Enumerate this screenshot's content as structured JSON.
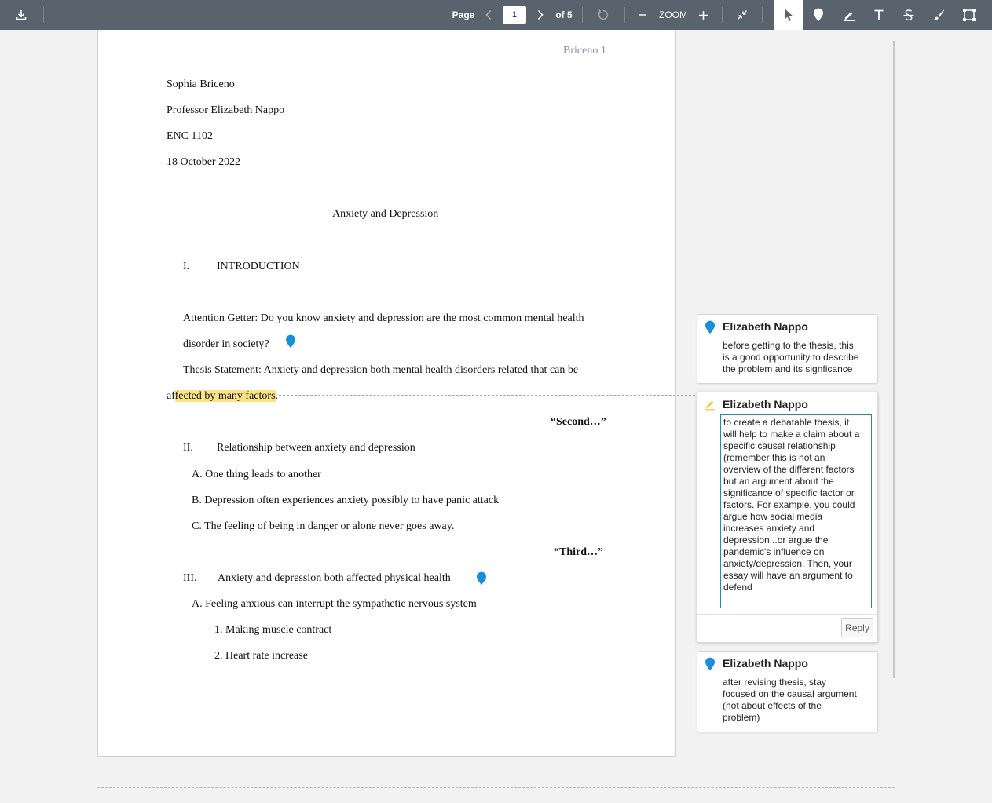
{
  "toolbar": {
    "page_label": "Page",
    "page_value": "1",
    "page_total": "of 5",
    "zoom_label": "ZOOM",
    "icons": [
      "download-icon",
      "chevron-left-icon",
      "chevron-right-icon",
      "rotate-icon",
      "minus-icon",
      "plus-icon",
      "collapse-icon",
      "pointer-icon",
      "pin-icon",
      "highlighter-icon",
      "text-icon",
      "strikethrough-icon",
      "brush-icon",
      "area-select-icon"
    ]
  },
  "document": {
    "header": "Briceno 1",
    "name": "Sophia Briceno",
    "professor": "Professor Elizabeth Nappo",
    "course": "ENC 1102",
    "date": "18 October 2022",
    "title": "Anxiety and Depression",
    "s1_num": "I.",
    "s1_title": "INTRODUCTION",
    "attention_1": "Attention Getter:  Do you know anxiety and depression are the most common mental health",
    "attention_2": "disorder in society?",
    "thesis_1": "Thesis Statement:  Anxiety and depression both mental health disorders related that can be",
    "thesis_2a": "af",
    "thesis_2b": "fected by many factors",
    "thesis_2c": ".",
    "second": "“Second…”",
    "s2_num": "II.",
    "s2_title": "Relationship between anxiety and depression",
    "s2_a": "A.  One thing leads to another",
    "s2_b": "B.  Depression often experiences anxiety possibly to have panic attack",
    "s2_c": "C.  The feeling of being in danger or alone never goes away.",
    "third": "“Third…”",
    "s3_num": "III.",
    "s3_title": "Anxiety and depression both affected physical health",
    "s3_a": "A.  Feeling anxious can interrupt the sympathetic nervous system",
    "s3_a1": "1.   Making muscle contract",
    "s3_a2": "2.   Heart rate increase"
  },
  "comments": [
    {
      "author": "Elizabeth Nappo",
      "icon": "pin-icon",
      "lines": [
        "before getting to the thesis, this",
        "is a good opportunity to describe",
        "the problem and its signficance"
      ]
    },
    {
      "author": "Elizabeth Nappo",
      "icon": "highlighter-icon",
      "lines": [
        "to create a debatable thesis, it",
        "will help to make a claim about a",
        "specific causal relationship",
        "(remember this is not an",
        "overview of the different factors",
        "but an argument about the",
        "significance of specific factor or",
        "factors. For example, you could",
        "argue how social media",
        "increases anxiety and",
        "depression...or argue the",
        "pandemic's influence on",
        "anxiety/depression. Then, your",
        "essay will have an argument to",
        "defend"
      ],
      "reply_label": "Reply"
    },
    {
      "author": "Elizabeth Nappo",
      "icon": "pin-icon",
      "lines": [
        "after revising thesis, stay",
        "focused on the causal argument",
        "(not about effects of the",
        "problem)"
      ]
    }
  ],
  "colors": {
    "toolbar": "#58636d",
    "highlight": "#fbe486",
    "pin": "#1a8fdc",
    "active_border": "#1d8fa8"
  }
}
